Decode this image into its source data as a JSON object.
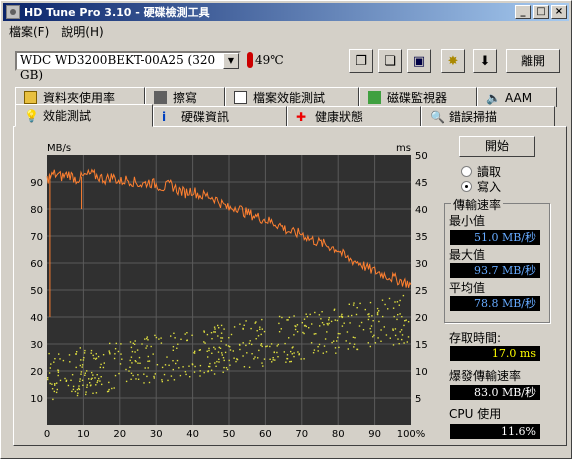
{
  "window": {
    "title": "HD Tune Pro 3.10 - 硬碟檢測工具"
  },
  "caption_buttons": [
    "_",
    "□",
    "×"
  ],
  "menu": [
    "檔案(F)",
    "說明(H)"
  ],
  "drive": {
    "label": "WDC WD3200BEKT-00A25 (320 GB)"
  },
  "temperature": "49℃",
  "toolbar": {
    "exit_label": "離開",
    "icons": [
      "copy-icon",
      "copy-alt-icon",
      "save-icon",
      "settings-icon",
      "download-icon"
    ]
  },
  "tabs_row1": [
    "資料夾使用率",
    "擦寫",
    "檔案效能測試",
    "磁碟監視器",
    "AAM"
  ],
  "tabs_row2": [
    "效能測試",
    "硬碟資訊",
    "健康狀態",
    "錯誤掃描"
  ],
  "controls": {
    "start_label": "開始",
    "read_label": "讀取",
    "write_label": "寫入",
    "mode_selected": "write"
  },
  "stats": {
    "transfer_rate_title": "傳輸速率",
    "min_label": "最小值",
    "min_value": "51.0 MB/秒",
    "max_label": "最大值",
    "max_value": "93.7 MB/秒",
    "avg_label": "平均值",
    "avg_value": "78.8 MB/秒",
    "access_label": "存取時間:",
    "access_value": "17.0 ms",
    "burst_label": "爆發傳輸速率",
    "burst_value": "83.0 MB/秒",
    "cpu_label": "CPU 使用",
    "cpu_value": "11.6%"
  },
  "chart_data": {
    "type": "line",
    "ylabel_left": "MB/s",
    "ylabel_right": "ms",
    "ylim_left": [
      0,
      100
    ],
    "ylim_right": [
      0,
      50
    ],
    "xlim": [
      0,
      100
    ],
    "x_ticks": [
      "0",
      "10",
      "20",
      "30",
      "40",
      "50",
      "60",
      "70",
      "80",
      "90",
      "100%"
    ],
    "y_left_ticks": [
      "10",
      "20",
      "30",
      "40",
      "50",
      "60",
      "70",
      "80",
      "90"
    ],
    "y_right_ticks": [
      "5",
      "10",
      "15",
      "20",
      "25",
      "30",
      "35",
      "40",
      "45",
      "50"
    ],
    "grid": true,
    "colors": {
      "bg": "#303030",
      "grid": "#5a5a5a",
      "line": "#ff8030",
      "dots": "#e0e040",
      "text": "#000000"
    },
    "series": [
      {
        "values_x": [
          0,
          2,
          4,
          6,
          8,
          10,
          12,
          14,
          16,
          18,
          20,
          22,
          24,
          26,
          28,
          30,
          32,
          34,
          36,
          38,
          40,
          42,
          44,
          46,
          48,
          50,
          52,
          54,
          56,
          58,
          60,
          62,
          64,
          66,
          68,
          70,
          72,
          74,
          76,
          78,
          80,
          82,
          84,
          86,
          88,
          90,
          92,
          94,
          96,
          98,
          100
        ],
        "values_y": [
          91,
          93,
          92,
          93,
          91,
          92,
          93,
          92,
          91,
          92,
          90,
          91,
          90,
          89,
          90,
          89,
          88,
          89,
          87,
          86,
          87,
          85,
          85,
          84,
          82,
          80,
          81,
          79,
          78,
          77,
          76,
          75,
          74,
          72,
          71,
          71,
          69,
          68,
          67,
          66,
          65,
          62,
          61,
          60,
          58,
          57,
          56,
          55,
          54,
          53,
          52
        ]
      }
    ]
  }
}
